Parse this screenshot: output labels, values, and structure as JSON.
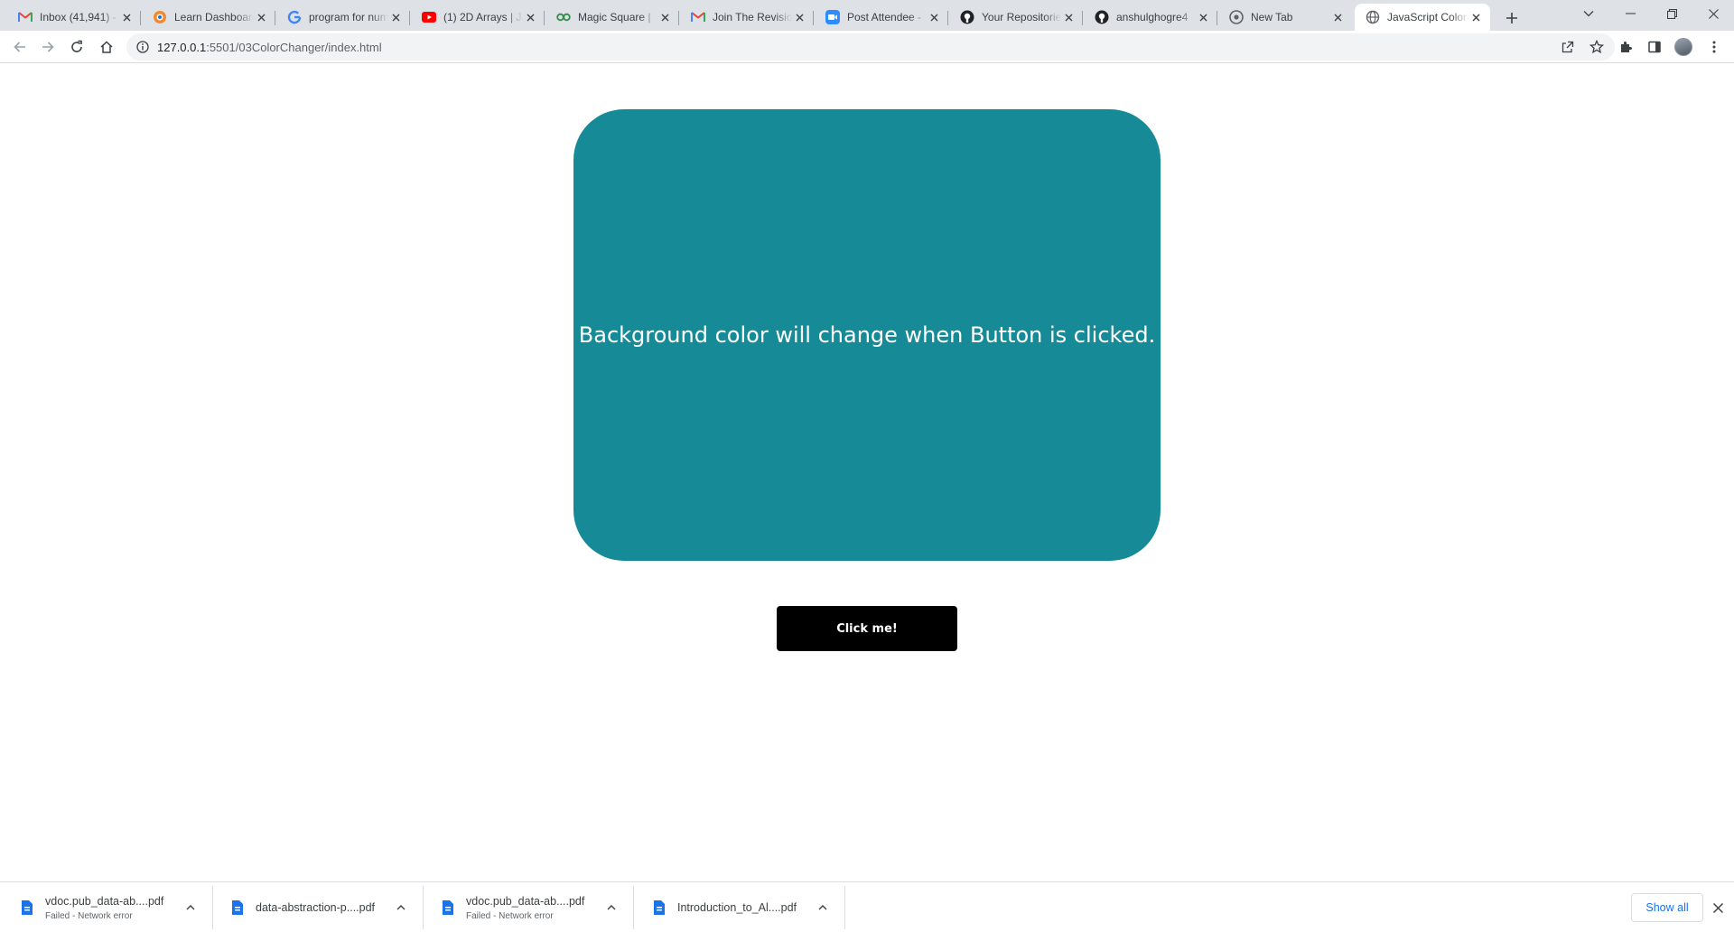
{
  "browser": {
    "tabs": [
      {
        "title": "Inbox (41,941) -",
        "icon": "gmail-icon"
      },
      {
        "title": "Learn Dashboard",
        "icon": "dashboard-icon"
      },
      {
        "title": "program for num",
        "icon": "google-icon"
      },
      {
        "title": "(1) 2D Arrays | Ja",
        "icon": "youtube-icon"
      },
      {
        "title": "Magic Square |",
        "icon": "geeksforgeeks-icon"
      },
      {
        "title": "Join The Revisio",
        "icon": "gmail-icon"
      },
      {
        "title": "Post Attendee -",
        "icon": "zoom-icon"
      },
      {
        "title": "Your Repositorie",
        "icon": "github-icon"
      },
      {
        "title": "anshulghogre4",
        "icon": "github-icon"
      },
      {
        "title": "New Tab",
        "icon": "chrome-icon"
      },
      {
        "title": "JavaScript Color",
        "icon": "globe-icon",
        "active": true
      }
    ],
    "address": {
      "host": "127.0.0.1",
      "path": ":5501/03ColorChanger/index.html"
    }
  },
  "page": {
    "box_text": "Background color will change when Button is clicked.",
    "box_color": "#168b97",
    "button_label": "Click me!"
  },
  "downloads": {
    "items": [
      {
        "name": "vdoc.pub_data-ab....pdf",
        "status": "Failed - Network error"
      },
      {
        "name": "data-abstraction-p....pdf",
        "status": ""
      },
      {
        "name": "vdoc.pub_data-ab....pdf",
        "status": "Failed - Network error"
      },
      {
        "name": "Introduction_to_Al....pdf",
        "status": ""
      }
    ],
    "show_all_label": "Show all"
  }
}
